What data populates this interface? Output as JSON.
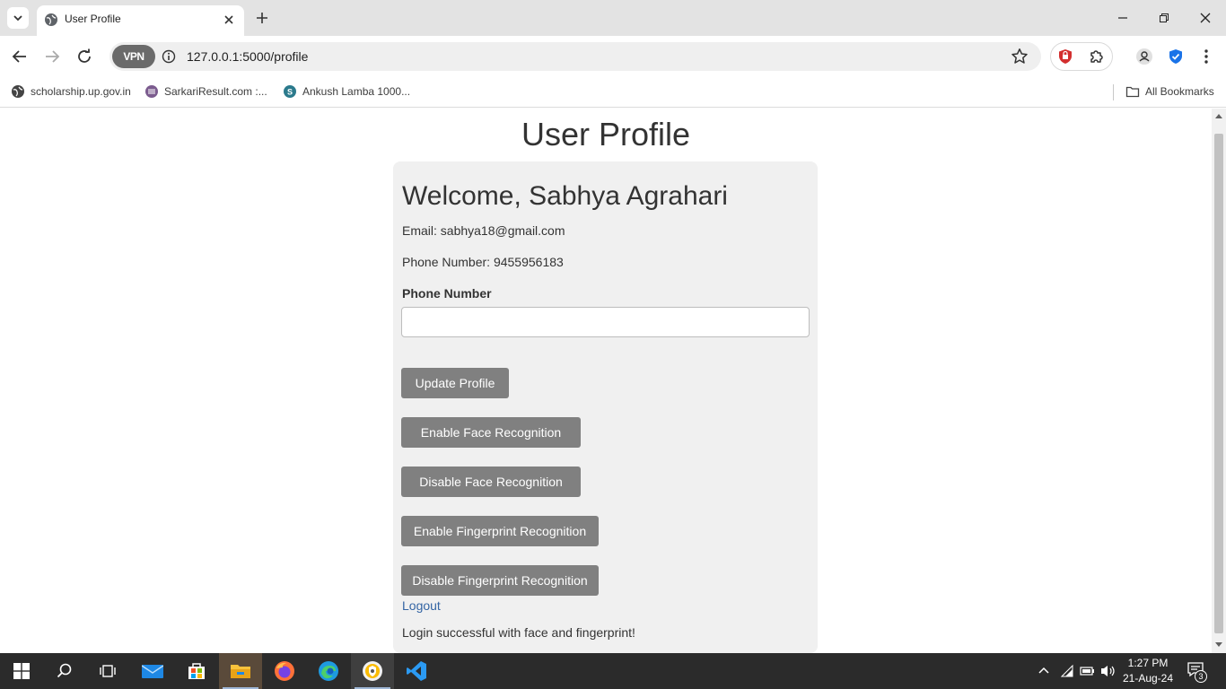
{
  "browser": {
    "tab_title": "User Profile",
    "url": "127.0.0.1:5000/profile",
    "vpn_label": "VPN",
    "bookmarks": [
      {
        "label": "scholarship.up.gov.in",
        "icon": "globe-icon"
      },
      {
        "label": "SarkariResult.com :...",
        "icon": "sarkari-icon"
      },
      {
        "label": "Ankush Lamba 1000...",
        "icon": "site-icon"
      }
    ],
    "all_bookmarks_label": "All Bookmarks"
  },
  "page": {
    "title": "User Profile",
    "welcome": "Welcome, Sabhya Agrahari",
    "email_line": "Email: sabhya18@gmail.com",
    "phone_line": "Phone Number: 9455956183",
    "phone_field_label": "Phone Number",
    "phone_field_value": "",
    "buttons": {
      "update": "Update Profile",
      "enable_face": "Enable Face Recognition",
      "disable_face": "Disable Face Recognition",
      "enable_fingerprint": "Enable Fingerprint Recognition",
      "disable_fingerprint": "Disable Fingerprint Recognition"
    },
    "logout": "Logout",
    "status_message": "Login successful with face and fingerprint!"
  },
  "taskbar": {
    "time": "1:27 PM",
    "date": "21-Aug-24",
    "notification_count": "3"
  },
  "colors": {
    "button_bg": "#808080",
    "card_bg": "#f0f0f0",
    "link": "#3465a4"
  }
}
